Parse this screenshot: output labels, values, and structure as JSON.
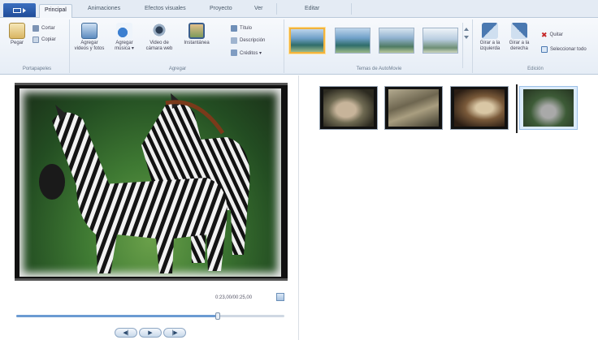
{
  "tabs": [
    {
      "label": "Principal",
      "active": true
    },
    {
      "label": "Animaciones",
      "active": false
    },
    {
      "label": "Efectos visuales",
      "active": false
    },
    {
      "label": "Proyecto",
      "active": false
    },
    {
      "label": "Ver",
      "active": false
    },
    {
      "label": "Editar",
      "active": false
    }
  ],
  "ribbon": {
    "clipboard": {
      "paste": "Pegar",
      "cut": "Cortar",
      "copy": "Copiar",
      "group_label": "Portapapeles"
    },
    "add": {
      "add_videos_photos": "Agregar videos y fotos",
      "add_music": "Agregar música ▾",
      "webcam_video": "Video de cámara web",
      "snapshot": "Instantánea",
      "title": "Título",
      "caption": "Descripción",
      "credits": "Créditos ▾",
      "group_label": "Agregar"
    },
    "themes": {
      "group_label": "Temas de AutoMovie"
    },
    "editing": {
      "rotate_left": "Girar a la izquierda",
      "rotate_right": "Girar a la derecha",
      "remove": "Quitar",
      "select_all": "Seleccionar todo",
      "group_label": "Edición"
    }
  },
  "preview": {
    "time": "0:23,00/00:25,00"
  },
  "playback": {
    "progress_fraction": 0.75,
    "prev_label": "◀|",
    "play_label": "▶",
    "next_label": "|▶"
  },
  "storyboard": {
    "clips": [
      {
        "name": "clip-squirrel",
        "selected": false
      },
      {
        "name": "clip-rock",
        "selected": false
      },
      {
        "name": "clip-animal",
        "selected": false
      },
      {
        "name": "clip-zebras",
        "selected": true
      }
    ]
  },
  "colors": {
    "accent": "#1f4c99",
    "selection_border": "#f2b33d",
    "seek_fill": "#6b9bd2"
  }
}
